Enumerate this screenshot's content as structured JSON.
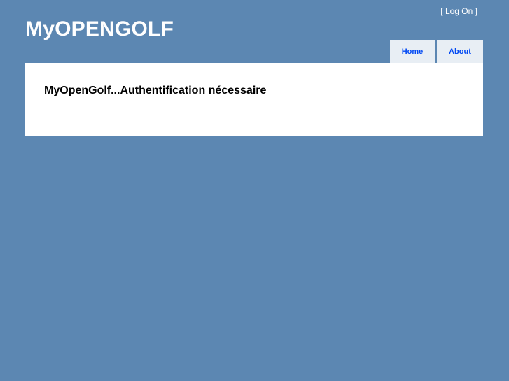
{
  "header": {
    "site_title": "MyOPENGOLF",
    "logon": {
      "open_bracket": "[",
      "link_label": "Log On",
      "close_bracket": "]"
    }
  },
  "nav": {
    "tabs": [
      {
        "label": "Home"
      },
      {
        "label": "About"
      }
    ]
  },
  "main": {
    "message": "MyOpenGolf...Authentification nécessaire"
  },
  "colors": {
    "page_background": "#5c87b2",
    "tab_background": "#e8eef4",
    "tab_text": "#034af3",
    "content_background": "#ffffff"
  }
}
